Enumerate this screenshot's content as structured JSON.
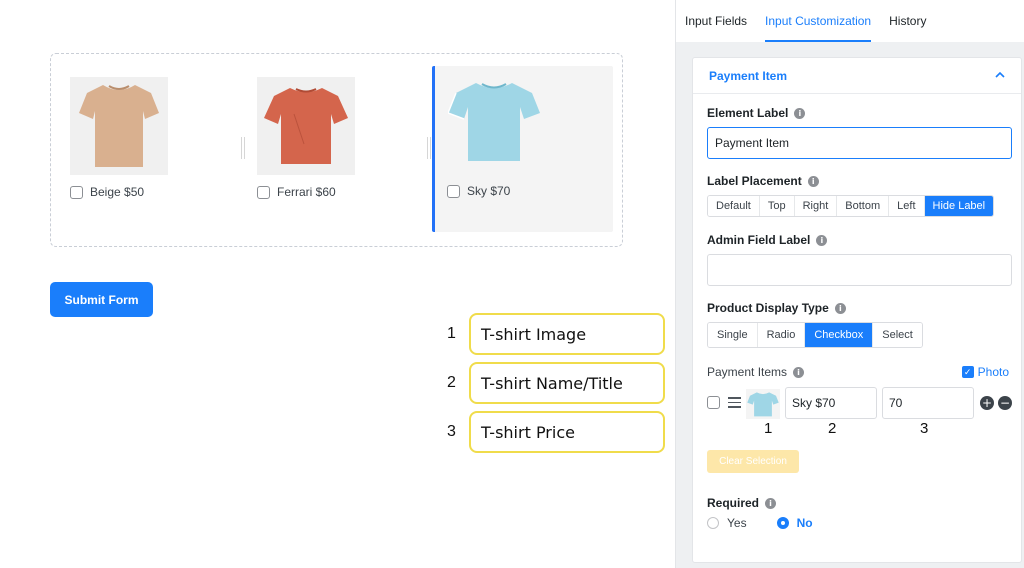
{
  "preview": {
    "products": [
      {
        "label": "Beige $50",
        "color": "#d9b08f",
        "icon": "tshirt-beige-image"
      },
      {
        "label": "Ferrari $60",
        "color": "#d4654c",
        "icon": "tshirt-ferrari-image"
      },
      {
        "label": "Sky $70",
        "color": "#9fd6e6",
        "icon": "tshirt-sky-image"
      }
    ],
    "submit_label": "Submit Form"
  },
  "callouts": [
    {
      "num": "1",
      "text": "T-shirt Image"
    },
    {
      "num": "2",
      "text": "T-shirt Name/Title"
    },
    {
      "num": "3",
      "text": "T-shirt Price"
    }
  ],
  "panel": {
    "tabs": [
      {
        "label": "Input Fields",
        "active": false
      },
      {
        "label": "Input Customization",
        "active": true
      },
      {
        "label": "History",
        "active": false
      }
    ],
    "section_title": "Payment Item",
    "element_label": {
      "title": "Element Label",
      "value": "Payment Item"
    },
    "label_placement": {
      "title": "Label Placement",
      "options": [
        "Default",
        "Top",
        "Right",
        "Bottom",
        "Left",
        "Hide Label"
      ],
      "selected": "Hide Label"
    },
    "admin_field_label": {
      "title": "Admin Field Label",
      "value": ""
    },
    "product_display_type": {
      "title": "Product Display Type",
      "options": [
        "Single",
        "Radio",
        "Checkbox",
        "Select"
      ],
      "selected": "Checkbox"
    },
    "payment_items": {
      "title": "Payment Items",
      "photo_label": "Photo",
      "photo_checked": true,
      "row": {
        "name": "Sky $70",
        "price": "70"
      },
      "column_numbers": [
        "1",
        "2",
        "3"
      ]
    },
    "clear_selection_label": "Clear Selection",
    "required": {
      "title": "Required",
      "options": [
        "Yes",
        "No"
      ],
      "selected": "No"
    }
  },
  "colors": {
    "accent": "#1a7efb",
    "callout_border": "#f0dc4b"
  }
}
